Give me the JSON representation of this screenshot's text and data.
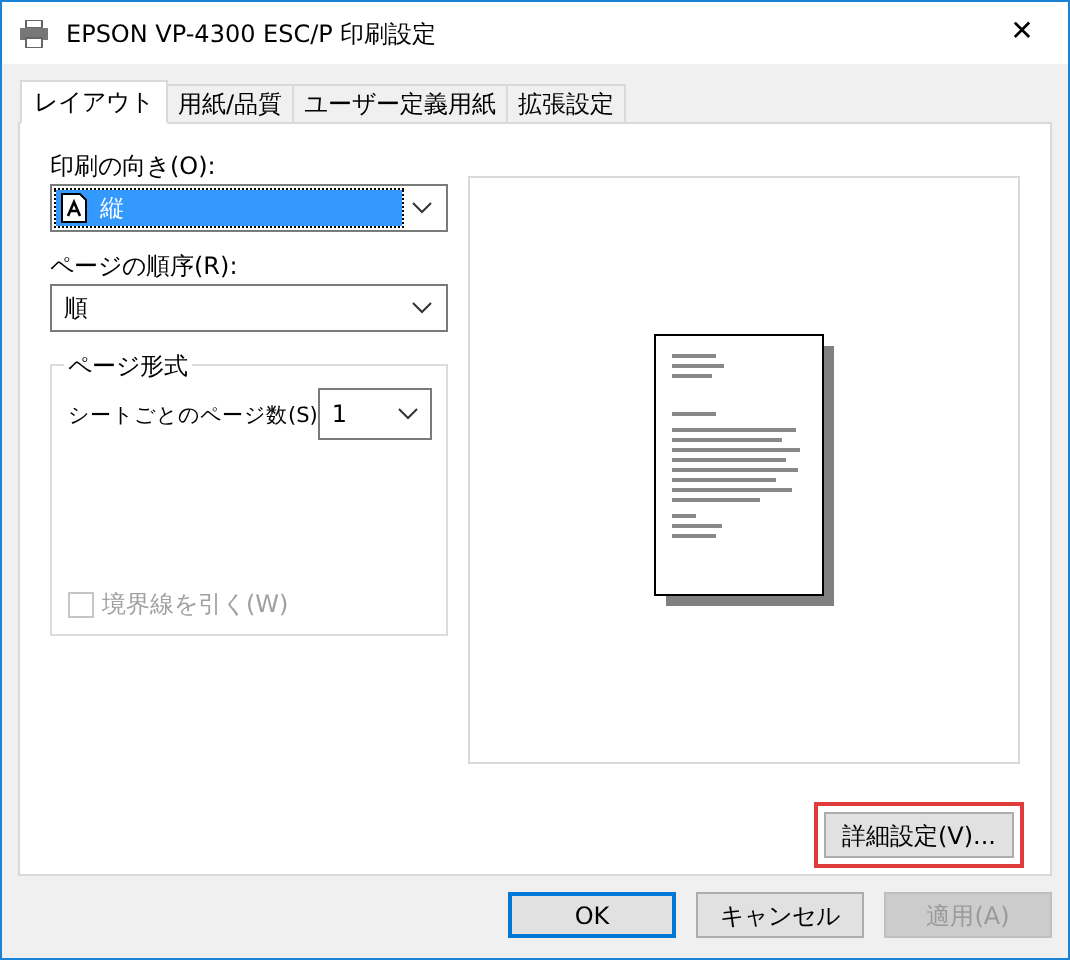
{
  "window": {
    "title": "EPSON VP-4300 ESC/P 印刷設定",
    "close": "✕"
  },
  "tabs": [
    {
      "label": "レイアウト",
      "selected": true
    },
    {
      "label": "用紙/品質",
      "selected": false
    },
    {
      "label": "ユーザー定義用紙",
      "selected": false
    },
    {
      "label": "拡張設定",
      "selected": false
    }
  ],
  "orientation": {
    "label": "印刷の向き(O):",
    "value": "縦",
    "focused": true
  },
  "page_order": {
    "label": "ページの順序(R):",
    "value": "順",
    "focused": false
  },
  "page_format": {
    "title": "ページ形式",
    "pages_per_sheet": {
      "label": "シートごとのページ数(S)",
      "value": "1"
    },
    "border": {
      "label": "境界線を引く(W)",
      "checked": false,
      "disabled": true
    }
  },
  "preview": {
    "kind": "portrait"
  },
  "advanced_button": {
    "label": "詳細設定(V)...",
    "highlighted": true
  },
  "buttons": [
    {
      "label": "OK",
      "default": true,
      "disabled": false
    },
    {
      "label": "キャンセル",
      "default": false,
      "disabled": false
    },
    {
      "label": "適用(A)",
      "default": false,
      "disabled": true
    }
  ]
}
